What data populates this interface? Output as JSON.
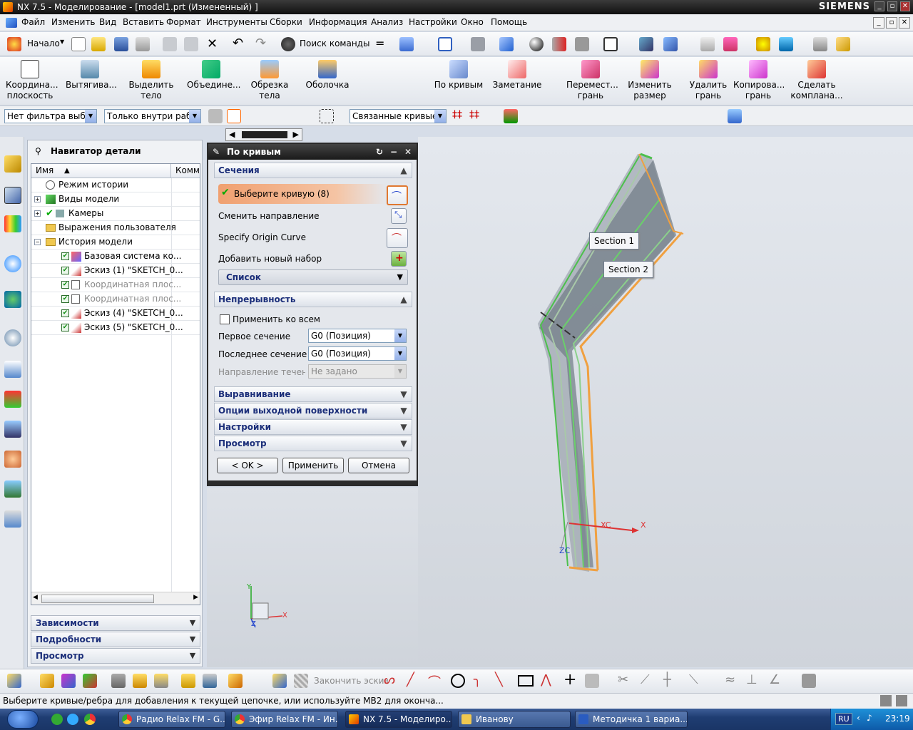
{
  "window": {
    "title": "NX 7.5 - Моделирование - [model1.prt (Измененный) ]",
    "brand": "SIEMENS"
  },
  "menu": [
    "Файл",
    "Изменить",
    "Вид",
    "Вставить",
    "Формат",
    "Инструменты",
    "Сборки",
    "Информация",
    "Анализ",
    "Настройки",
    "Окно",
    "Помощь"
  ],
  "toolbar1": {
    "start": "Начало",
    "search": "Поиск команды"
  },
  "toolbar2": [
    {
      "l1": "Координа...",
      "l2": "плоскость"
    },
    {
      "l1": "Вытягива...",
      "l2": ""
    },
    {
      "l1": "Выделить",
      "l2": "тело"
    },
    {
      "l1": "Объедине...",
      "l2": ""
    },
    {
      "l1": "Обрезка",
      "l2": "тела"
    },
    {
      "l1": "Оболочка",
      "l2": ""
    },
    {
      "l1": "По кривым",
      "l2": ""
    },
    {
      "l1": "Заметание",
      "l2": ""
    },
    {
      "l1": "Перемест...",
      "l2": "грань"
    },
    {
      "l1": "Изменить",
      "l2": "размер"
    },
    {
      "l1": "Удалить",
      "l2": "грань"
    },
    {
      "l1": "Копирова...",
      "l2": "грань"
    },
    {
      "l1": "Сделать",
      "l2": "компланa..."
    }
  ],
  "filters": {
    "type": "Нет фильтра выбора",
    "scope": "Только внутри рабо",
    "curve_rule": "Связанные кривые"
  },
  "navigator": {
    "title": "Навигатор детали",
    "col_name": "Имя",
    "col_comment": "Комм",
    "rows": [
      {
        "label": "Режим истории",
        "dim": false
      },
      {
        "label": "Виды модели",
        "dim": false
      },
      {
        "label": "Камеры",
        "dim": false
      },
      {
        "label": "Выражения пользователя",
        "dim": false
      },
      {
        "label": "История модели",
        "dim": false
      },
      {
        "label": "Базовая система ко...",
        "dim": false
      },
      {
        "label": "Эскиз (1) \"SKETCH_0...",
        "dim": false
      },
      {
        "label": "Координатная плос...",
        "dim": true
      },
      {
        "label": "Координатная плос...",
        "dim": true
      },
      {
        "label": "Эскиз (4) \"SKETCH_0...",
        "dim": false
      },
      {
        "label": "Эскиз (5) \"SKETCH_0...",
        "dim": false
      }
    ],
    "sections": [
      "Зависимости",
      "Подробности",
      "Просмотр"
    ]
  },
  "dialog": {
    "title": "По кривым",
    "sec_sections": "Сечения",
    "select_curve": "Выберите кривую (8)",
    "reverse": "Сменить направление",
    "origin": "Specify Origin Curve",
    "add_set": "Добавить новый набор",
    "list": "Список",
    "sec_continuity": "Непрерывность",
    "apply_all": "Применить ко всем",
    "first_section": "Первое сечение",
    "first_value": "G0 (Позиция)",
    "last_section": "Последнее сечение",
    "last_value": "G0 (Позиция)",
    "flow_dir": "Направление течения",
    "flow_value": "Не задано",
    "sec_alignment": "Выравнивание",
    "sec_output": "Опции выходной поверхности",
    "sec_settings": "Настройки",
    "sec_preview": "Просмотр",
    "ok": "< OK >",
    "apply": "Применить",
    "cancel": "Отмена"
  },
  "viewport": {
    "section1": "Section  1",
    "section2": "Section  2",
    "xc": "XC",
    "zc": "ZC",
    "x": "X",
    "y": "Y",
    "z": "Z"
  },
  "bottom_toolbar": {
    "finish_sketch": "Закончить эскиз"
  },
  "status": "Выберите кривые/ребра для добавления к текущей цепочке, или используйте MB2 для оконча...",
  "taskbar": {
    "tasks": [
      "Радио Relax FM - G...",
      "Эфир Relax FM - Ин...",
      "NX 7.5 - Моделиро...",
      "Иванову",
      "Методичка 1 вариа..."
    ],
    "lang": "RU",
    "time": "23:19"
  }
}
